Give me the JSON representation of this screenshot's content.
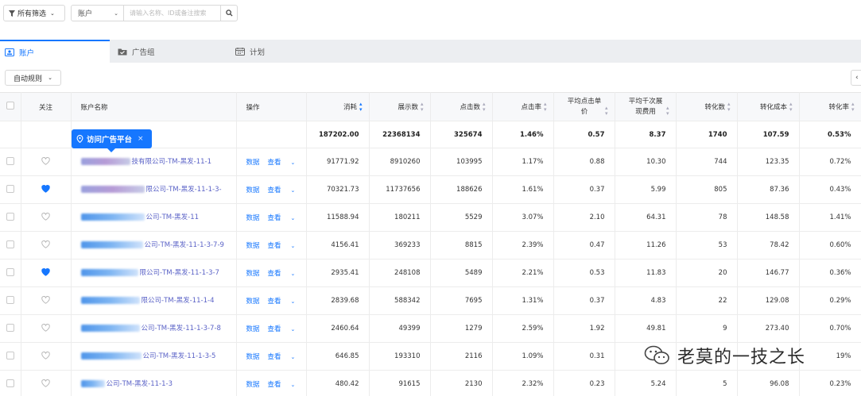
{
  "toolbar": {
    "filter_label": "所有筛选",
    "search_type": "账户",
    "search_placeholder": "请输入名称、ID或备注搜索"
  },
  "tabs": [
    {
      "label": "账户",
      "icon": "account-card-icon",
      "active": true
    },
    {
      "label": "广告组",
      "icon": "folder-check-icon",
      "active": false
    },
    {
      "label": "计划",
      "icon": "calendar-icon",
      "active": false
    }
  ],
  "auto_rule_label": "自动规则",
  "tooltip": {
    "label": "访问广告平台",
    "close": "×"
  },
  "columns": {
    "follow": "关注",
    "name": "账户名称",
    "ops": "操作",
    "cost": "消耗",
    "impressions": "展示数",
    "clicks": "点击数",
    "ctr": "点击率",
    "cpc": "平均点击单价",
    "cpm": "平均千次展现费用",
    "conversions": "转化数",
    "cpa": "转化成本",
    "cvr": "转化率"
  },
  "summary": {
    "cost": "187202.00",
    "impressions": "22368134",
    "clicks": "325674",
    "ctr": "1.46%",
    "cpc": "0.57",
    "cpm": "8.37",
    "conversions": "1740",
    "cpa": "107.59",
    "cvr": "0.53%"
  },
  "row_actions": {
    "data": "数据",
    "view": "查看"
  },
  "rows": [
    {
      "name": "技有限公司-TM-黑发-11-1",
      "favorited": false,
      "cost": "91771.92",
      "impressions": "8910260",
      "clicks": "103995",
      "ctr": "1.17%",
      "cpc": "0.88",
      "cpm": "10.30",
      "conversions": "744",
      "cpa": "123.35",
      "cvr": "0.72%"
    },
    {
      "name": "限公司-TM-黑发-11-1-3-",
      "favorited": true,
      "cost": "70321.73",
      "impressions": "11737656",
      "clicks": "188626",
      "ctr": "1.61%",
      "cpc": "0.37",
      "cpm": "5.99",
      "conversions": "805",
      "cpa": "87.36",
      "cvr": "0.43%"
    },
    {
      "name": "公司-TM-黑发-11",
      "favorited": false,
      "cost": "11588.94",
      "impressions": "180211",
      "clicks": "5529",
      "ctr": "3.07%",
      "cpc": "2.10",
      "cpm": "64.31",
      "conversions": "78",
      "cpa": "148.58",
      "cvr": "1.41%"
    },
    {
      "name": "公司-TM-黑发-11-1-3-7-9",
      "favorited": false,
      "cost": "4156.41",
      "impressions": "369233",
      "clicks": "8815",
      "ctr": "2.39%",
      "cpc": "0.47",
      "cpm": "11.26",
      "conversions": "53",
      "cpa": "78.42",
      "cvr": "0.60%"
    },
    {
      "name": "限公司-TM-黑发-11-1-3-7",
      "favorited": true,
      "cost": "2935.41",
      "impressions": "248108",
      "clicks": "5489",
      "ctr": "2.21%",
      "cpc": "0.53",
      "cpm": "11.83",
      "conversions": "20",
      "cpa": "146.77",
      "cvr": "0.36%"
    },
    {
      "name": "限公司-TM-黑发-11-1-4",
      "favorited": false,
      "cost": "2839.68",
      "impressions": "588342",
      "clicks": "7695",
      "ctr": "1.31%",
      "cpc": "0.37",
      "cpm": "4.83",
      "conversions": "22",
      "cpa": "129.08",
      "cvr": "0.29%"
    },
    {
      "name": "公司-TM-黑发-11-1-3-7-8",
      "favorited": false,
      "cost": "2460.64",
      "impressions": "49399",
      "clicks": "1279",
      "ctr": "2.59%",
      "cpc": "1.92",
      "cpm": "49.81",
      "conversions": "9",
      "cpa": "273.40",
      "cvr": "0.70%"
    },
    {
      "name": "公司-TM-黑发-11-1-3-5",
      "favorited": false,
      "cost": "646.85",
      "impressions": "193310",
      "clicks": "2116",
      "ctr": "1.09%",
      "cpc": "0.31",
      "cpm": "",
      "conversions": "",
      "cpa": "",
      "cvr": "19%"
    },
    {
      "name": "公司-TM-黑发-11-1-3",
      "favorited": false,
      "cost": "480.42",
      "impressions": "91615",
      "clicks": "2130",
      "ctr": "2.32%",
      "cpc": "0.23",
      "cpm": "5.24",
      "conversions": "5",
      "cpa": "96.08",
      "cvr": "0.23%"
    }
  ],
  "watermark": "老莫的一技之长",
  "colors": {
    "accent": "#1677ff",
    "link": "#5b63c7",
    "heart": "#1677ff"
  }
}
